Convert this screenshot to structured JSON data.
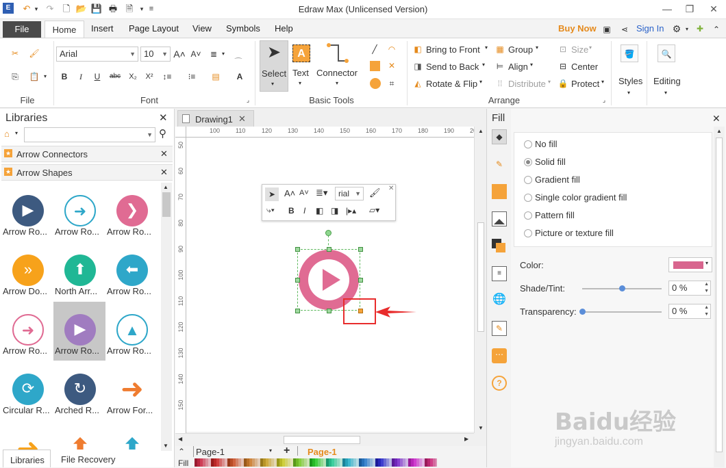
{
  "window": {
    "title": "Edraw Max (Unlicensed Version)"
  },
  "tabs": {
    "file": "File",
    "items": [
      "Home",
      "Insert",
      "Page Layout",
      "View",
      "Symbols",
      "Help"
    ],
    "active": "Home"
  },
  "header_right": {
    "buy_now": "Buy Now",
    "sign_in": "Sign In"
  },
  "ribbon": {
    "groups": {
      "file": "File",
      "font": "Font",
      "basic_tools": "Basic Tools",
      "arrange": "Arrange"
    },
    "font_name": "Arial",
    "font_size": "10",
    "tools": {
      "select": "Select",
      "text": "Text",
      "connector": "Connector"
    },
    "arrange": {
      "bring_to_front": "Bring to Front",
      "send_to_back": "Send to Back",
      "rotate_flip": "Rotate & Flip",
      "group": "Group",
      "align": "Align",
      "distribute": "Distribute",
      "size": "Size",
      "center": "Center",
      "protect": "Protect"
    },
    "styles": "Styles",
    "editing": "Editing"
  },
  "libraries": {
    "title": "Libraries",
    "search_placeholder": "",
    "sections": [
      "Arrow Connectors",
      "Arrow Shapes"
    ],
    "items": [
      {
        "label": "Arrow Ro...",
        "color": "#3d5a80",
        "icon": "play-icon",
        "style": "filled"
      },
      {
        "label": "Arrow Ro...",
        "color": "#2ea7c9",
        "icon": "arrow-right-icon",
        "style": "outline"
      },
      {
        "label": "Arrow Ro...",
        "color": "#e06b93",
        "icon": "chevron-right-icon",
        "style": "filled"
      },
      {
        "label": "Arrow Do...",
        "color": "#f7a21b",
        "icon": "double-chevron-icon",
        "style": "filled"
      },
      {
        "label": "North Arr...",
        "color": "#20b795",
        "icon": "arrow-up-icon",
        "style": "filled"
      },
      {
        "label": "Arrow Ro...",
        "color": "#2ea7c9",
        "icon": "arrow-left-icon",
        "style": "filled"
      },
      {
        "label": "Arrow Ro...",
        "color": "#e06b93",
        "icon": "arrow-right-icon",
        "style": "outline"
      },
      {
        "label": "Arrow Ro...",
        "color": "#a07cc0",
        "icon": "play-icon",
        "style": "selected"
      },
      {
        "label": "Arrow Ro...",
        "color": "#2ea7c9",
        "icon": "triangle-up-icon",
        "style": "outline"
      },
      {
        "label": "Circular R...",
        "color": "#2ea7c9",
        "icon": "circular-arrows-icon",
        "style": "filled"
      },
      {
        "label": "Arched R...",
        "color": "#3d5a80",
        "icon": "arched-arrow-icon",
        "style": "filled"
      },
      {
        "label": "Arrow For...",
        "color": "#ef7c30",
        "icon": "arrow-forward-icon",
        "style": "plain"
      },
      {
        "label": "",
        "color": "#f7a21b",
        "icon": "arrow-right-icon",
        "style": "plain"
      },
      {
        "label": "",
        "color": "#ef7c30",
        "icon": "arrow-up-icon",
        "style": "plain"
      },
      {
        "label": "",
        "color": "#2ea7c9",
        "icon": "arrow-up-icon",
        "style": "plain"
      }
    ],
    "bottom_tabs": [
      "Libraries",
      "File Recovery"
    ]
  },
  "document": {
    "tab_name": "Drawing1",
    "ruler_h": [
      "100",
      "110",
      "120",
      "130",
      "140",
      "150",
      "160",
      "170",
      "180",
      "190",
      "20"
    ],
    "ruler_v": [
      "50",
      "60",
      "70",
      "80",
      "90",
      "100",
      "110",
      "120",
      "130",
      "140",
      "150"
    ],
    "floating_toolbar_font": "rial",
    "shape_color": "#e06b93"
  },
  "bottom": {
    "page_selector": "Page-1",
    "active_page": "Page-1",
    "fill_label": "Fill"
  },
  "fill_panel": {
    "title": "Fill",
    "options": [
      "No fill",
      "Solid fill",
      "Gradient fill",
      "Single color gradient fill",
      "Pattern fill",
      "Picture or texture fill"
    ],
    "selected": "Solid fill",
    "color_label": "Color:",
    "color_value": "#d8658e",
    "shade_label": "Shade/Tint:",
    "shade_value": "0 %",
    "shade_level": 0.5,
    "transparency_label": "Transparency:",
    "transparency_value": "0 %",
    "transparency_level": 0
  },
  "watermark": {
    "text1": "Baidu经验",
    "text2": "jingyan.baidu.com"
  }
}
